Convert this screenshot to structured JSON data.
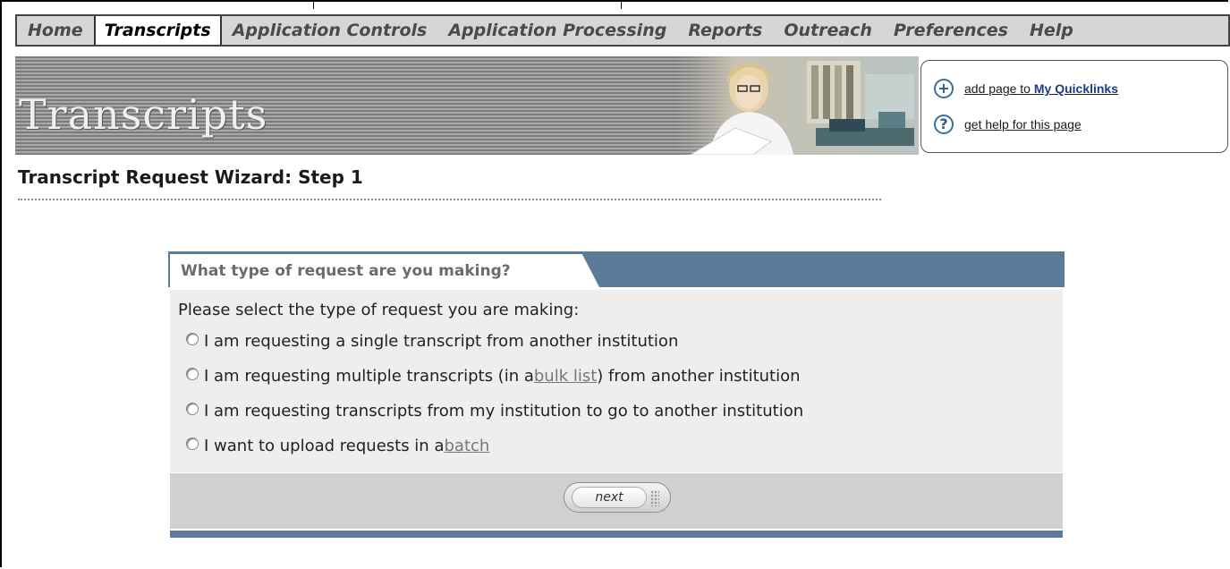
{
  "nav": {
    "items": [
      {
        "label": "Home",
        "active": false
      },
      {
        "label": "Transcripts",
        "active": true
      },
      {
        "label": "Application Controls",
        "active": false
      },
      {
        "label": "Application Processing",
        "active": false
      },
      {
        "label": "Reports",
        "active": false
      },
      {
        "label": "Outreach",
        "active": false
      },
      {
        "label": "Preferences",
        "active": false
      },
      {
        "label": "Help",
        "active": false
      }
    ]
  },
  "banner": {
    "title": "Transcripts"
  },
  "quicklinks": {
    "add_prefix": "add page to ",
    "add_strong": "My Quicklinks",
    "help": "get help for this page",
    "add_icon": "plus-icon",
    "help_icon": "question-icon"
  },
  "page": {
    "title": "Transcript Request Wizard: Step 1"
  },
  "wizard": {
    "tab_label": "What type of request are you making?",
    "prompt": "Please select the type of request you are making:",
    "options": [
      {
        "before": "I am requesting a single transcript from another institution",
        "link": "",
        "after": ""
      },
      {
        "before": "I am requesting multiple transcripts (in a ",
        "link": "bulk list",
        "after": ") from another institution"
      },
      {
        "before": "I am requesting transcripts from my institution to go to another institution",
        "link": "",
        "after": ""
      },
      {
        "before": "I want to upload requests in a ",
        "link": "batch",
        "after": ""
      }
    ],
    "next_label": "next"
  },
  "colors": {
    "panel_header": "#5b7b98",
    "panel_body": "#eeeeee",
    "panel_footer": "#d0d0d0",
    "nav_bg": "#d6d6d6"
  }
}
